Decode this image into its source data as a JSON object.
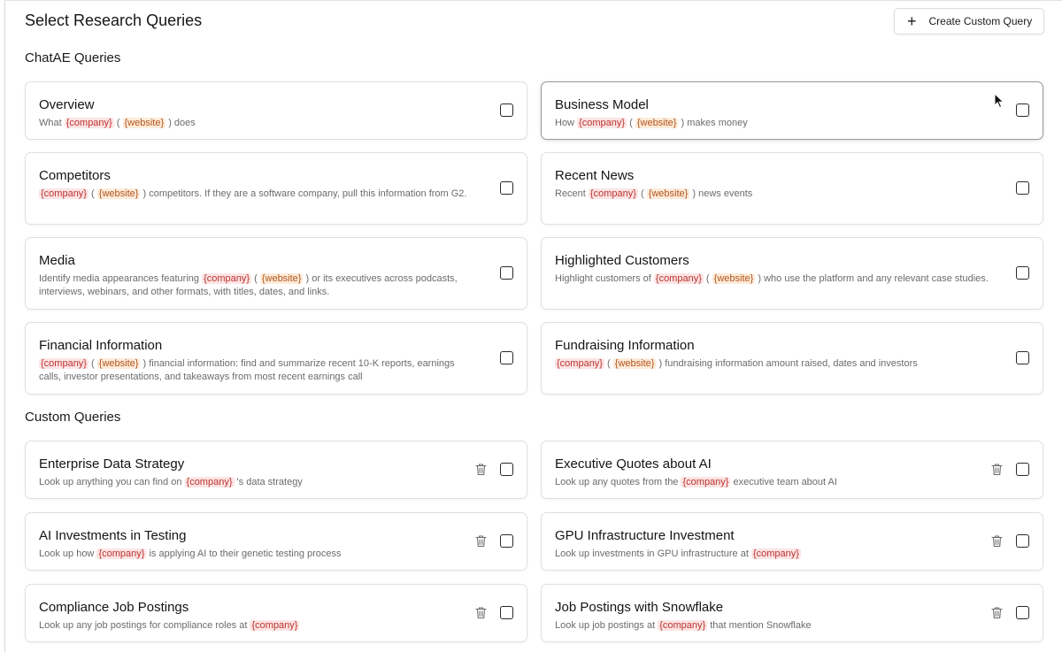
{
  "header": {
    "title": "Select Research Queries",
    "create_button_label": "Create Custom Query",
    "create_button_icon": "plus-icon"
  },
  "sections": {
    "chatae_title": "ChatAE Queries",
    "custom_title": "Custom Queries"
  },
  "tokens": {
    "company": "{company}",
    "website": "{website}"
  },
  "chatae_queries": [
    {
      "title": "Overview",
      "desc": [
        "What ",
        "{company}",
        " ( ",
        "{website}",
        " ) does"
      ]
    },
    {
      "title": "Business Model",
      "desc": [
        "How ",
        "{company}",
        " ( ",
        "{website}",
        " ) makes money"
      ]
    },
    {
      "title": "Competitors",
      "desc": [
        "",
        "{company}",
        " ( ",
        "{website}",
        " ) competitors. If they are a software company, pull this information from G2."
      ]
    },
    {
      "title": "Recent News",
      "desc": [
        "Recent ",
        "{company}",
        " ( ",
        "{website}",
        " ) news events"
      ]
    },
    {
      "title": "Media",
      "desc": [
        "Identify media appearances featuring ",
        "{company}",
        " ( ",
        "{website}",
        " ) or its executives across podcasts, interviews, webinars, and other formats, with titles, dates, and links."
      ]
    },
    {
      "title": "Highlighted Customers",
      "desc": [
        "Highlight customers of ",
        "{company}",
        " ( ",
        "{website}",
        " ) who use the platform and any relevant case studies."
      ]
    },
    {
      "title": "Financial Information",
      "desc": [
        "",
        "{company}",
        " ( ",
        "{website}",
        " ) financial information: find and summarize recent 10-K reports, earnings calls, investor presentations, and takeaways from most recent earnings call"
      ]
    },
    {
      "title": "Fundraising Information",
      "desc": [
        "",
        "{company}",
        " ( ",
        "{website}",
        " ) fundraising information amount raised, dates and investors"
      ]
    }
  ],
  "custom_queries": [
    {
      "title": "Enterprise Data Strategy",
      "desc": [
        "Look up anything you can find on ",
        "{company}",
        " 's data strategy"
      ]
    },
    {
      "title": "Executive Quotes about AI",
      "desc": [
        "Look up any quotes from the ",
        "{company}",
        " executive team about AI"
      ]
    },
    {
      "title": "AI Investments in Testing",
      "desc": [
        "Look up how ",
        "{company}",
        " is applying AI to their genetic testing process"
      ]
    },
    {
      "title": "GPU Infrastructure Investment",
      "desc": [
        "Look up investments in GPU infrastructure at ",
        "{company}",
        ""
      ]
    },
    {
      "title": "Compliance Job Postings",
      "desc": [
        "Look up any job postings for compliance roles at ",
        "{company}",
        ""
      ]
    },
    {
      "title": "Job Postings with Snowflake",
      "desc": [
        "Look up job postings at ",
        "{company}",
        " that mention Snowflake"
      ]
    }
  ],
  "colors": {
    "token_company_bg": "#fde4e4",
    "token_company_fg": "#b9342f",
    "token_website_bg": "#fdebd9",
    "token_website_fg": "#b4561f",
    "border": "#e0e0e0"
  }
}
